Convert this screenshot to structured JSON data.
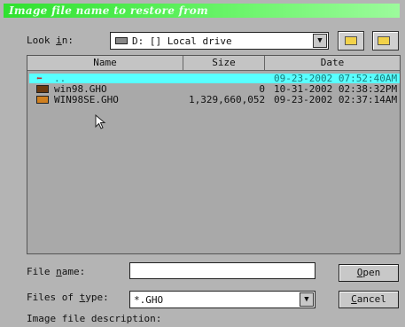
{
  "window": {
    "title": "Image file name to restore from"
  },
  "look_in": {
    "label_pre": "Look ",
    "label_key": "i",
    "label_post": "n:",
    "value": "D: [] Local drive"
  },
  "list": {
    "columns": [
      "Name",
      "Size",
      "Date"
    ],
    "rows": [
      {
        "name": "..",
        "size": "",
        "date": "09-23-2002 07:52:40AM",
        "icon": "up-arrow-icon",
        "selected": true
      },
      {
        "name": "win98.GHO",
        "size": "0",
        "date": "10-31-2002 02:38:32PM",
        "icon": "image-file-icon",
        "selected": false
      },
      {
        "name": "WIN98SE.GHO",
        "size": "1,329,660,052",
        "date": "09-23-2002 02:37:14AM",
        "icon": "image-file-icon",
        "selected": false
      }
    ]
  },
  "file_name": {
    "label_pre": "File ",
    "label_key": "n",
    "label_post": "ame:",
    "value": ""
  },
  "files_of_type": {
    "label_pre": "Files of ",
    "label_key": "t",
    "label_post": "ype:",
    "value": "*.GHO"
  },
  "description": {
    "label": "Image file description:"
  },
  "buttons": {
    "open_key": "O",
    "open_rest": "pen",
    "cancel_key": "C",
    "cancel_rest": "ancel"
  },
  "colors": {
    "title_bar": "#2fe12f",
    "selection": "#58ffff",
    "dialog_bg": "#b4b4b4"
  }
}
